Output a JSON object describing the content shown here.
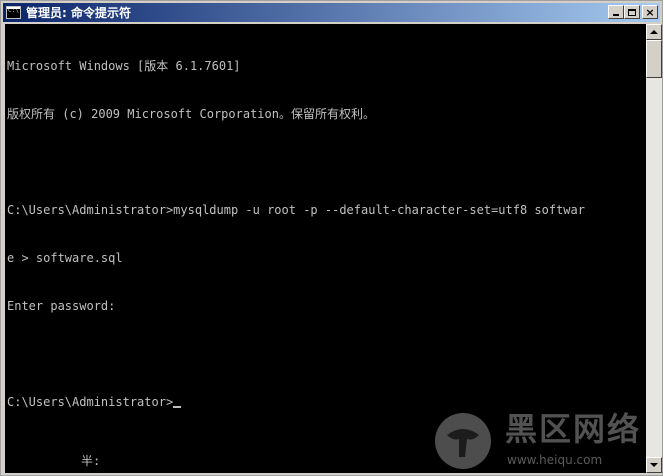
{
  "window": {
    "title": "管理员: 命令提示符",
    "icon_text": "C:\\",
    "buttons": {
      "minimize": "minimize-icon",
      "maximize": "maximize-icon",
      "close": "close-icon",
      "close_glyph": "×"
    }
  },
  "console": {
    "lines": [
      "Microsoft Windows [版本 6.1.7601]",
      "版权所有 (c) 2009 Microsoft Corporation。保留所有权利。",
      "",
      "C:\\Users\\Administrator>mysqldump -u root -p --default-character-set=utf8 softwar",
      "e > software.sql",
      "Enter password:",
      "",
      "C:\\Users\\Administrator>"
    ],
    "ime_status": "半:"
  },
  "watermark": {
    "title": "黑区网络",
    "url": "www.heiqu.com"
  },
  "colors": {
    "titlebar_start": "#0a246a",
    "titlebar_end": "#a6caf0",
    "console_bg": "#000000",
    "console_text": "#c0c0c0"
  }
}
